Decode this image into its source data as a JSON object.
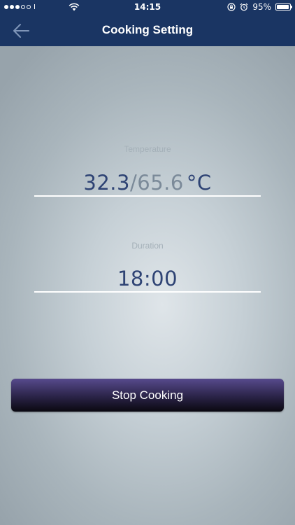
{
  "status_bar": {
    "time": "14:15",
    "battery_percent_label": "95%",
    "battery_level": 0.95,
    "signal_bars_filled": 3,
    "signal_bars_total": 5
  },
  "nav": {
    "title": "Cooking Setting",
    "back_icon": "arrow-left-icon"
  },
  "temperature": {
    "label": "Temperature",
    "current": "32.3",
    "separator": "/",
    "target": "65.6",
    "unit": "°C"
  },
  "duration": {
    "label": "Duration",
    "value": "18:00"
  },
  "actions": {
    "stop_label": "Stop Cooking"
  },
  "colors": {
    "header": "#1a3563",
    "value_text": "#2e4374",
    "button_top": "#574a8c",
    "button_bottom": "#0a0810"
  }
}
